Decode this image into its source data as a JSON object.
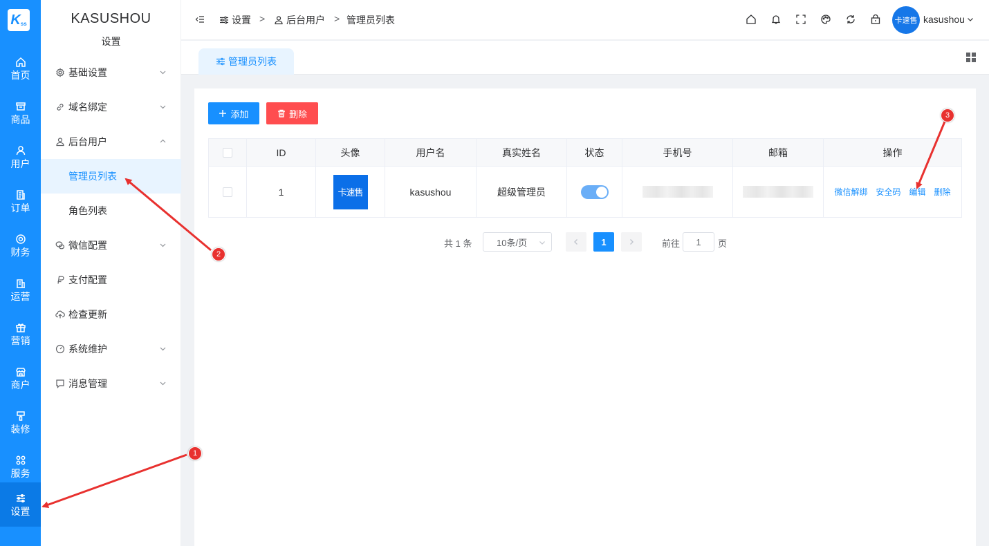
{
  "rail": {
    "logo_main": "K",
    "logo_sub": "ss",
    "items": [
      {
        "label": "首页",
        "icon": "home-icon"
      },
      {
        "label": "商品",
        "icon": "box-icon"
      },
      {
        "label": "用户",
        "icon": "user-icon"
      },
      {
        "label": "订单",
        "icon": "order-icon"
      },
      {
        "label": "财务",
        "icon": "finance-icon"
      },
      {
        "label": "运营",
        "icon": "operation-icon"
      },
      {
        "label": "营销",
        "icon": "gift-icon"
      },
      {
        "label": "商户",
        "icon": "shop-icon"
      },
      {
        "label": "装修",
        "icon": "decorate-icon"
      },
      {
        "label": "服务",
        "icon": "service-icon"
      },
      {
        "label": "设置",
        "icon": "settings-icon"
      }
    ]
  },
  "sidebar": {
    "brand": "KASUSHOU",
    "section": "设置",
    "items": [
      {
        "label": "基础设置"
      },
      {
        "label": "域名绑定"
      },
      {
        "label": "后台用户"
      },
      {
        "label": "管理员列表"
      },
      {
        "label": "角色列表"
      },
      {
        "label": "微信配置"
      },
      {
        "label": "支付配置"
      },
      {
        "label": "检查更新"
      },
      {
        "label": "系统维护"
      },
      {
        "label": "消息管理"
      }
    ]
  },
  "header": {
    "breadcrumb": [
      "设置",
      "后台用户",
      "管理员列表"
    ],
    "separator": ">",
    "avatar_text": "卡速售",
    "username": "kasushou"
  },
  "tabs": [
    {
      "label": "管理员列表"
    }
  ],
  "toolbar": {
    "add_label": "添加",
    "delete_label": "删除"
  },
  "table": {
    "columns": [
      "ID",
      "头像",
      "用户名",
      "真实姓名",
      "状态",
      "手机号",
      "邮箱",
      "操作"
    ],
    "rows": [
      {
        "id": "1",
        "avatar_text": "卡速售",
        "username": "kasushou",
        "real_name": "超级管理员",
        "status": "on"
      }
    ],
    "actions": [
      "微信解绑",
      "安全码",
      "编辑",
      "删除"
    ]
  },
  "pagination": {
    "total": "共 1 条",
    "page_size": "10条/页",
    "current_page": "1",
    "goto_label": "前往",
    "goto_value": "1",
    "page_unit": "页"
  },
  "annotations": {
    "badges": [
      "1",
      "2",
      "3"
    ],
    "color": "#e8312f"
  },
  "colors": {
    "primary": "#1890ff",
    "danger": "#ff4d4f"
  }
}
